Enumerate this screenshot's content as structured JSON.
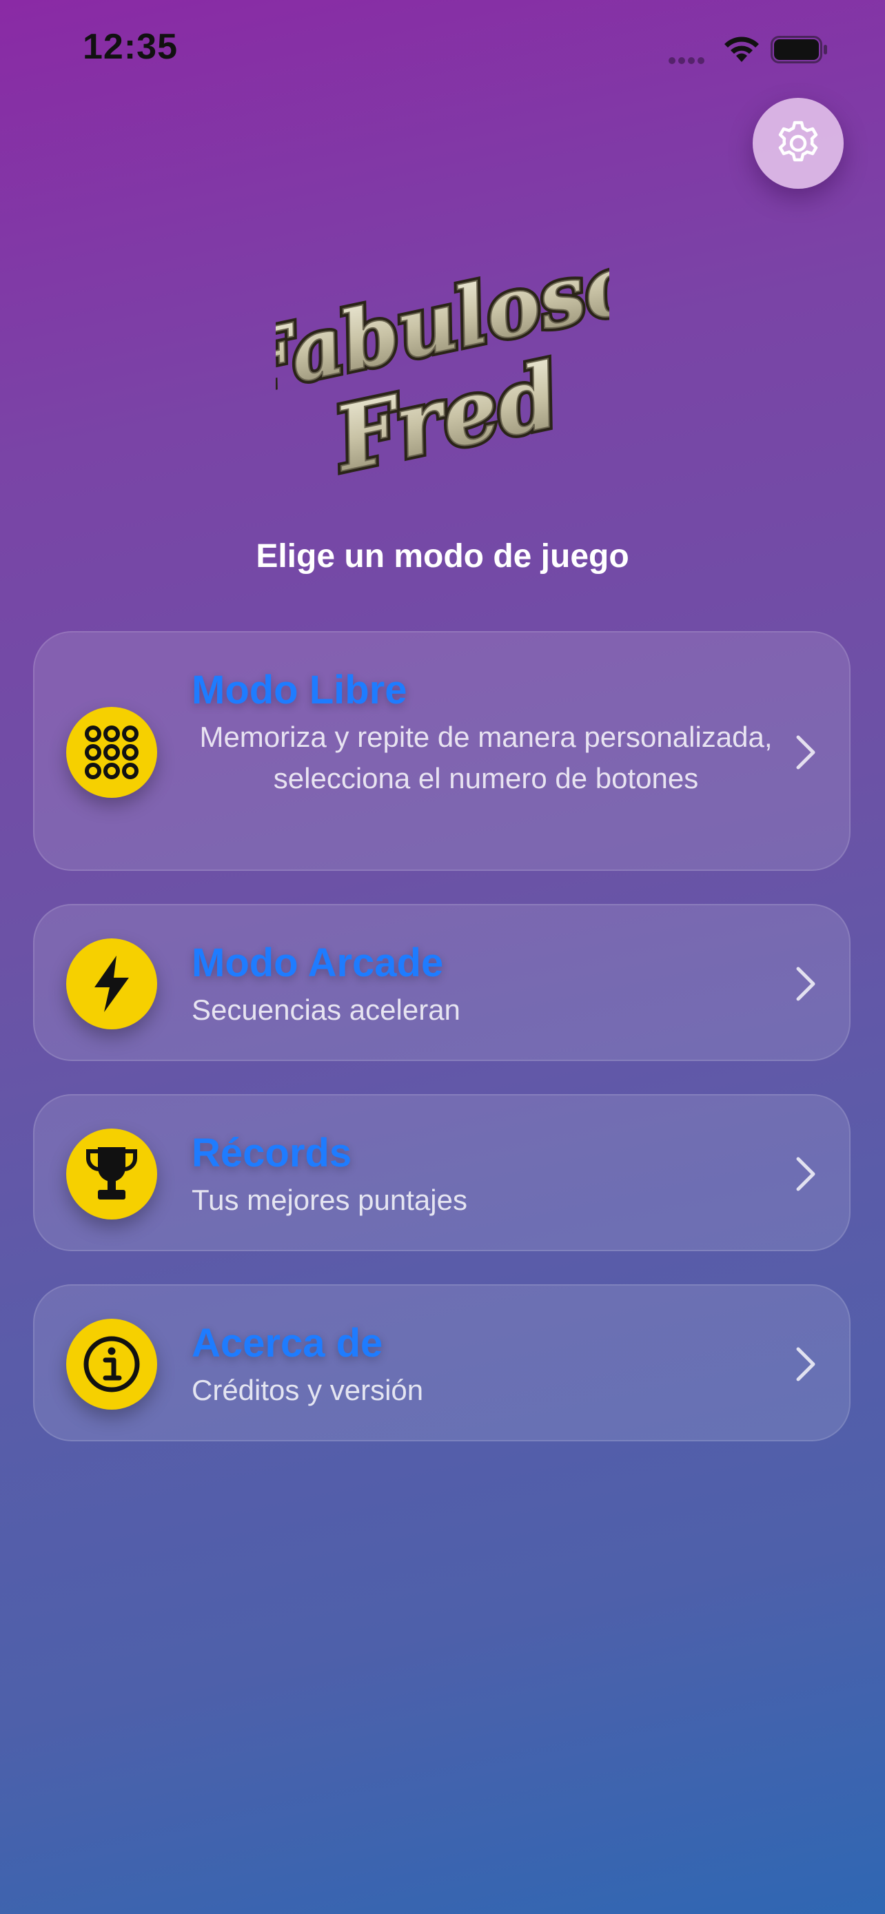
{
  "status_bar": {
    "time": "12:35"
  },
  "logo": {
    "line1": "Fabuloso",
    "line2": "Fred"
  },
  "subtitle": "Elige un modo de juego",
  "menu": [
    {
      "title": "Modo Libre",
      "description": "Memoriza y repite de manera personalizada, selecciona el numero de botones",
      "icon": "keypad-grid-icon"
    },
    {
      "title": "Modo Arcade",
      "description": "Secuencias aceleran",
      "icon": "lightning-bolt-icon"
    },
    {
      "title": "Récords",
      "description": "Tus mejores puntajes",
      "icon": "trophy-icon"
    },
    {
      "title": "Acerca de",
      "description": "Créditos y versión",
      "icon": "info-icon"
    }
  ],
  "colors": {
    "title_blue": "#1e7cff",
    "icon_yellow": "#f6d000",
    "gradient_top": "#8a2aa5",
    "gradient_bottom": "#2f67b3"
  }
}
